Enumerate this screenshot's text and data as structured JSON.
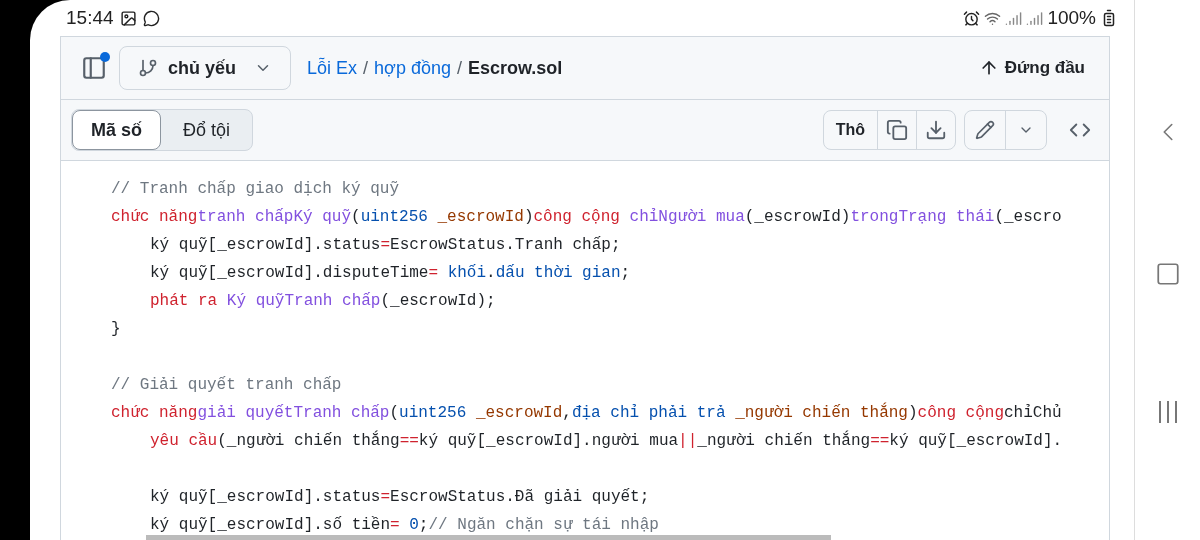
{
  "status_bar": {
    "time": "15:44",
    "battery": "100%"
  },
  "header": {
    "branch": "chủ yếu",
    "breadcrumb": [
      "Lỗi Ex",
      "hợp đồng",
      "Escrow.sol"
    ],
    "separator": "/",
    "top_link": "Đứng đầu"
  },
  "tabs": [
    {
      "label": "Mã số",
      "selected": true
    },
    {
      "label": "Đổ tội",
      "selected": false
    }
  ],
  "toolbar": {
    "raw": "Thô"
  },
  "code_lines": [
    {
      "kind": "code",
      "indented": false,
      "tokens": [
        {
          "kind": "comment",
          "text": "// Tranh chấp giao dịch ký quỹ"
        }
      ]
    },
    {
      "kind": "code",
      "indented": false,
      "tokens": [
        {
          "kind": "keyword",
          "text": "chức năng"
        },
        {
          "kind": "entity",
          "text": "tranh chấpKý quỹ"
        },
        {
          "kind": "plain",
          "text": "("
        },
        {
          "kind": "type",
          "text": "uint256"
        },
        {
          "kind": "variable",
          "text": " _escrowId"
        },
        {
          "kind": "plain",
          "text": ")"
        },
        {
          "kind": "keyword",
          "text": "công cộng"
        },
        {
          "kind": "entity",
          "text": " chỉNgười mua"
        },
        {
          "kind": "plain",
          "text": "(_escrowId)"
        },
        {
          "kind": "entity",
          "text": "trongTrạng thái"
        },
        {
          "kind": "plain",
          "text": "(_escro"
        }
      ]
    },
    {
      "kind": "code",
      "indented": true,
      "tokens": [
        {
          "kind": "plain",
          "text": "ký quỹ[_escrowId].status"
        },
        {
          "kind": "keyword",
          "text": "="
        },
        {
          "kind": "plain",
          "text": "EscrowStatus.Tranh chấp;"
        }
      ]
    },
    {
      "kind": "code",
      "indented": true,
      "tokens": [
        {
          "kind": "plain",
          "text": "ký quỹ[_escrowId].disputeTime"
        },
        {
          "kind": "keyword",
          "text": "="
        },
        {
          "kind": "type",
          "text": " khối"
        },
        {
          "kind": "plain",
          "text": "."
        },
        {
          "kind": "type",
          "text": "dấu thời gian"
        },
        {
          "kind": "plain",
          "text": ";"
        }
      ]
    },
    {
      "kind": "code",
      "indented": true,
      "tokens": [
        {
          "kind": "keyword",
          "text": "phát ra"
        },
        {
          "kind": "entity",
          "text": " Ký quỹTranh chấp"
        },
        {
          "kind": "plain",
          "text": "(_escrowId);"
        }
      ]
    },
    {
      "kind": "code",
      "indented": false,
      "tokens": [
        {
          "kind": "plain",
          "text": "}"
        }
      ]
    },
    {
      "kind": "blank"
    },
    {
      "kind": "code",
      "indented": false,
      "tokens": [
        {
          "kind": "comment",
          "text": "// Giải quyết tranh chấp"
        }
      ]
    },
    {
      "kind": "code",
      "indented": false,
      "tokens": [
        {
          "kind": "keyword",
          "text": "chức năng"
        },
        {
          "kind": "entity",
          "text": "giải quyếtTranh chấp"
        },
        {
          "kind": "plain",
          "text": "("
        },
        {
          "kind": "type",
          "text": "uint256"
        },
        {
          "kind": "variable",
          "text": " _escrowId"
        },
        {
          "kind": "plain",
          "text": ","
        },
        {
          "kind": "type",
          "text": "địa chỉ phải trả"
        },
        {
          "kind": "variable",
          "text": " _người chiến thắng"
        },
        {
          "kind": "plain",
          "text": ")"
        },
        {
          "kind": "keyword",
          "text": "công cộng"
        },
        {
          "kind": "plain",
          "text": "chỉChủ"
        }
      ]
    },
    {
      "kind": "code",
      "indented": true,
      "tokens": [
        {
          "kind": "keyword",
          "text": "yêu cầu"
        },
        {
          "kind": "plain",
          "text": "(_người chiến thắng"
        },
        {
          "kind": "keyword",
          "text": "=="
        },
        {
          "kind": "plain",
          "text": "ký quỹ[_escrowId].người mua"
        },
        {
          "kind": "keyword",
          "text": "||"
        },
        {
          "kind": "plain",
          "text": "_người chiến thắng"
        },
        {
          "kind": "keyword",
          "text": "=="
        },
        {
          "kind": "plain",
          "text": "ký quỹ[_escrowId]."
        }
      ]
    },
    {
      "kind": "blank"
    },
    {
      "kind": "code",
      "indented": true,
      "tokens": [
        {
          "kind": "plain",
          "text": "ký quỹ[_escrowId].status"
        },
        {
          "kind": "keyword",
          "text": "="
        },
        {
          "kind": "plain",
          "text": "EscrowStatus.Đã giải quyết;"
        }
      ]
    },
    {
      "kind": "code",
      "indented": true,
      "tokens": [
        {
          "kind": "plain",
          "text": "ký quỹ[_escrowId].số tiền"
        },
        {
          "kind": "keyword",
          "text": "="
        },
        {
          "kind": "type",
          "text": " 0"
        },
        {
          "kind": "plain",
          "text": ";"
        },
        {
          "kind": "comment",
          "text": "// Ngăn chặn sự tái nhập"
        }
      ]
    }
  ]
}
